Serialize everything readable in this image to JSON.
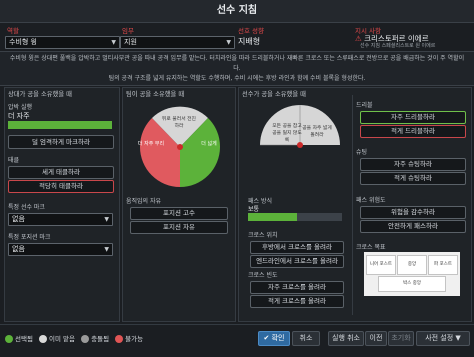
{
  "title": "선수 지침",
  "top": {
    "role_label": "역할",
    "role_value": "수비형 윙",
    "duty_label": "임무",
    "duty_value": "지원",
    "preferred_label": "선호 성향",
    "preferred_value": "지배형",
    "instruction_label": "지시 사항",
    "instruction_value": "크리스토퍼르 이에르",
    "instruction_sub": "선수 지침 스페셜리스트로 원 이에르"
  },
  "description": [
    "수비형 윙은 상대편 풀백을 압박하고 멀티사부관 공을 따내 공격 임무를 맡는다. 터치라인을 따라 드리블하거나 재빠른 크로스 또는 스루패스로 전방으로 공을 배급하는 것이 주 역할이다.",
    "팀의 공격 구조를 넓게 유지하는 역할도 수행하며, 수비 시에는 후방 라인과 함께 수비 블록을 형성한다."
  ],
  "left": {
    "header": "상대가 공을 소유했을 때",
    "press_label": "압박 실행",
    "press_value": "더 자주",
    "press_button": "덜 엄격하게 마크하라",
    "tackle_label": "태클",
    "tackle_button1": "세게 태클하라",
    "tackle_button2": "적당히 태클하라",
    "mark_player_label": "특정 선수 마크",
    "mark_player_value": "없음",
    "mark_pos_label": "특정 포지션 마크",
    "mark_pos_value": "없음"
  },
  "middle": {
    "header": "팀이 공을 소유했을 때",
    "freedom_label": "움직임의 자유",
    "freedom_button1": "포지션 고수",
    "freedom_button2": "포지션 자유",
    "semi_left": "더 자주 무리",
    "semi_top": "뒤로 물러서 전진하라",
    "semi_right": "더 넓게"
  },
  "right": {
    "header": "선수가 공을 소유했을 때",
    "semi_left": "모든 공을 잡고 공을 잃지 않도록",
    "semi_right": "공을 자주 넓게 돌려라",
    "pass_style_label": "패스 방식",
    "pass_style_value": "보통",
    "cross_pos_label": "크로스 위치",
    "cross_pos_btn1": "후방에서 크로스를 올려라",
    "cross_pos_btn2": "엔드라인에서 크로스를 올려라",
    "cross_freq_label": "크로스 빈도",
    "cross_freq_btn1": "자주 크로스를 올려라",
    "cross_freq_btn2": "적게 크로스를 올려라",
    "dribble_label": "드리블",
    "dribble_btn1": "자주 드리블하라",
    "dribble_btn2": "적게 드리블하라",
    "shoot_label": "슈팅",
    "shoot_btn1": "자주 슈팅하라",
    "shoot_btn2": "적게 슈팅하라",
    "pass_risk_label": "패스 위험도",
    "pass_risk_btn1": "위험을 감수하라",
    "pass_risk_btn2": "안전하게 패스하라",
    "cross_target_label": "크로스 목표",
    "target_near": "니어 포스트",
    "target_center": "중앙",
    "target_far": "파 포스트",
    "target_area": "박스 중앙"
  },
  "legend": {
    "selected": "선택됨",
    "already": "이미 맡음",
    "conflict": "충돌됨",
    "unavailable": "불가능"
  },
  "footer": {
    "confirm": "확인",
    "cancel": "취소",
    "undo": "실행 취소",
    "prev": "이전",
    "reset": "초기화",
    "presets": "사전 설정"
  },
  "colors": {
    "selected": "#5cb23a",
    "already": "#d9d9d9",
    "conflict": "#9a9a9a",
    "unavailable": "#e05555",
    "accent": "#e2494b"
  }
}
